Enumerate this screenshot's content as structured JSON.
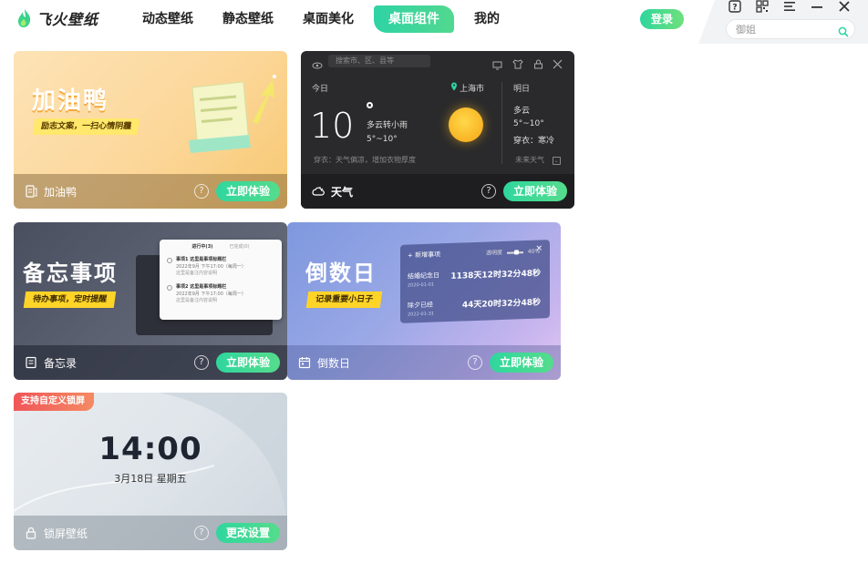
{
  "app": {
    "logo_text": "飞火壁纸",
    "nav": [
      "动态壁纸",
      "静态壁纸",
      "桌面美化",
      "桌面组件",
      "我的"
    ],
    "active_nav": "桌面组件",
    "login_label": "登录",
    "search": {
      "placeholder": "御姐"
    }
  },
  "colors": {
    "accent": "#2ed3a4",
    "badge": "#f0565a"
  },
  "cards": [
    {
      "name": "加油鸭",
      "banner_title": "加油鸭",
      "banner_sub": "励志文案，一扫心情阴霾",
      "help": "?",
      "button": "立即体验"
    },
    {
      "name": "天气",
      "search_placeholder": "搜索市、区、县等",
      "today_label": "今日",
      "temperature": "10",
      "condition": "多云转小雨",
      "range": "5°~10°",
      "location": "上海市",
      "tomorrow_label": "明日",
      "tomorrow_condition": "多云",
      "tomorrow_range": "5°~10°",
      "tomorrow_wear": "穿衣：寒冷",
      "tip": "穿衣：天气偏凉，增加衣物厚度",
      "future": "未来天气",
      "help": "?",
      "button": "立即体验"
    },
    {
      "name": "备忘录",
      "banner_title": "备忘事项",
      "banner_sub": "待办事项，定时提醒",
      "tab_active": "进行中(3)",
      "tab_other": "已完成(0)",
      "todo_items": [
        {
          "title": "事项1 这里是事项标题栏",
          "time": "2022年9月 下午17:00（每周一）",
          "note": "这里是备注内容说明"
        },
        {
          "title": "事项2 这里是事项标题栏",
          "time": "2022年9月 下午17:00（每周一）",
          "note": "这里是备注内容说明"
        }
      ],
      "help": "?",
      "button": "立即体验"
    },
    {
      "name": "倒数日",
      "banner_title": "倒数日",
      "banner_sub": "记录重要小日子",
      "panel_add": "+ 新增事项",
      "panel_opacity": "透明度",
      "panel_opacity_value": "40%",
      "events": [
        {
          "name": "结婚纪念日",
          "date": "2020-01-01",
          "value": "1138天12时32分48秒"
        },
        {
          "name": "除夕已经",
          "date": "2022-01-31",
          "value": "44天20时32分48秒"
        }
      ],
      "help": "?",
      "button": "立即体验"
    },
    {
      "name": "锁屏壁纸",
      "badge": "支持自定义锁屏",
      "time": "14:00",
      "date": "3月18日  星期五",
      "help": "?",
      "button": "更改设置"
    }
  ]
}
